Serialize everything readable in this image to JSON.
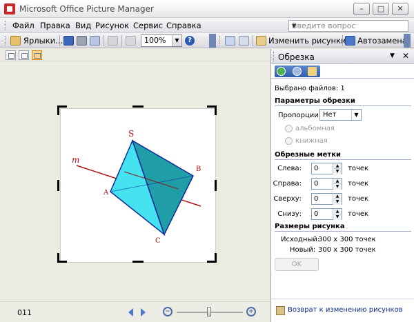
{
  "window": {
    "title": "Microsoft Office Picture Manager"
  },
  "menu": {
    "items": [
      "Файл",
      "Правка",
      "Вид",
      "Рисунок",
      "Сервис",
      "Справка"
    ],
    "ask_placeholder": "Введите вопрос"
  },
  "toolbar": {
    "shortcuts_label": "Ярлыки...",
    "zoom_value": "100%",
    "edit_pictures_label": "Изменить рисунки...",
    "autocorrect_label": "Автозамена"
  },
  "picture": {
    "labels": {
      "s": "S",
      "a": "A",
      "b": "B",
      "c": "C",
      "m": "m"
    }
  },
  "status": {
    "count": "011"
  },
  "pane": {
    "title": "Обрезка",
    "selected_files": "Выбрано файлов: 1",
    "crop_params_title": "Параметры обрезки",
    "ratio_label": "Пропорции:",
    "ratio_value": "Нет",
    "landscape_label": "альбомная",
    "portrait_label": "книжная",
    "crop_marks_title": "Обрезные метки",
    "left_label": "Слева:",
    "right_label": "Справа:",
    "top_label": "Сверху:",
    "bottom_label": "Снизу:",
    "left_value": "0",
    "right_value": "0",
    "top_value": "0",
    "bottom_value": "0",
    "unit": "точек",
    "size_title": "Размеры рисунка",
    "original_label": "Исходный:",
    "original_value": "300 x 300 точек",
    "new_label": "Новый:",
    "new_value": "300 x 300 точек",
    "ok_label": "OK",
    "back_label": "Возврат к изменению рисунков"
  }
}
